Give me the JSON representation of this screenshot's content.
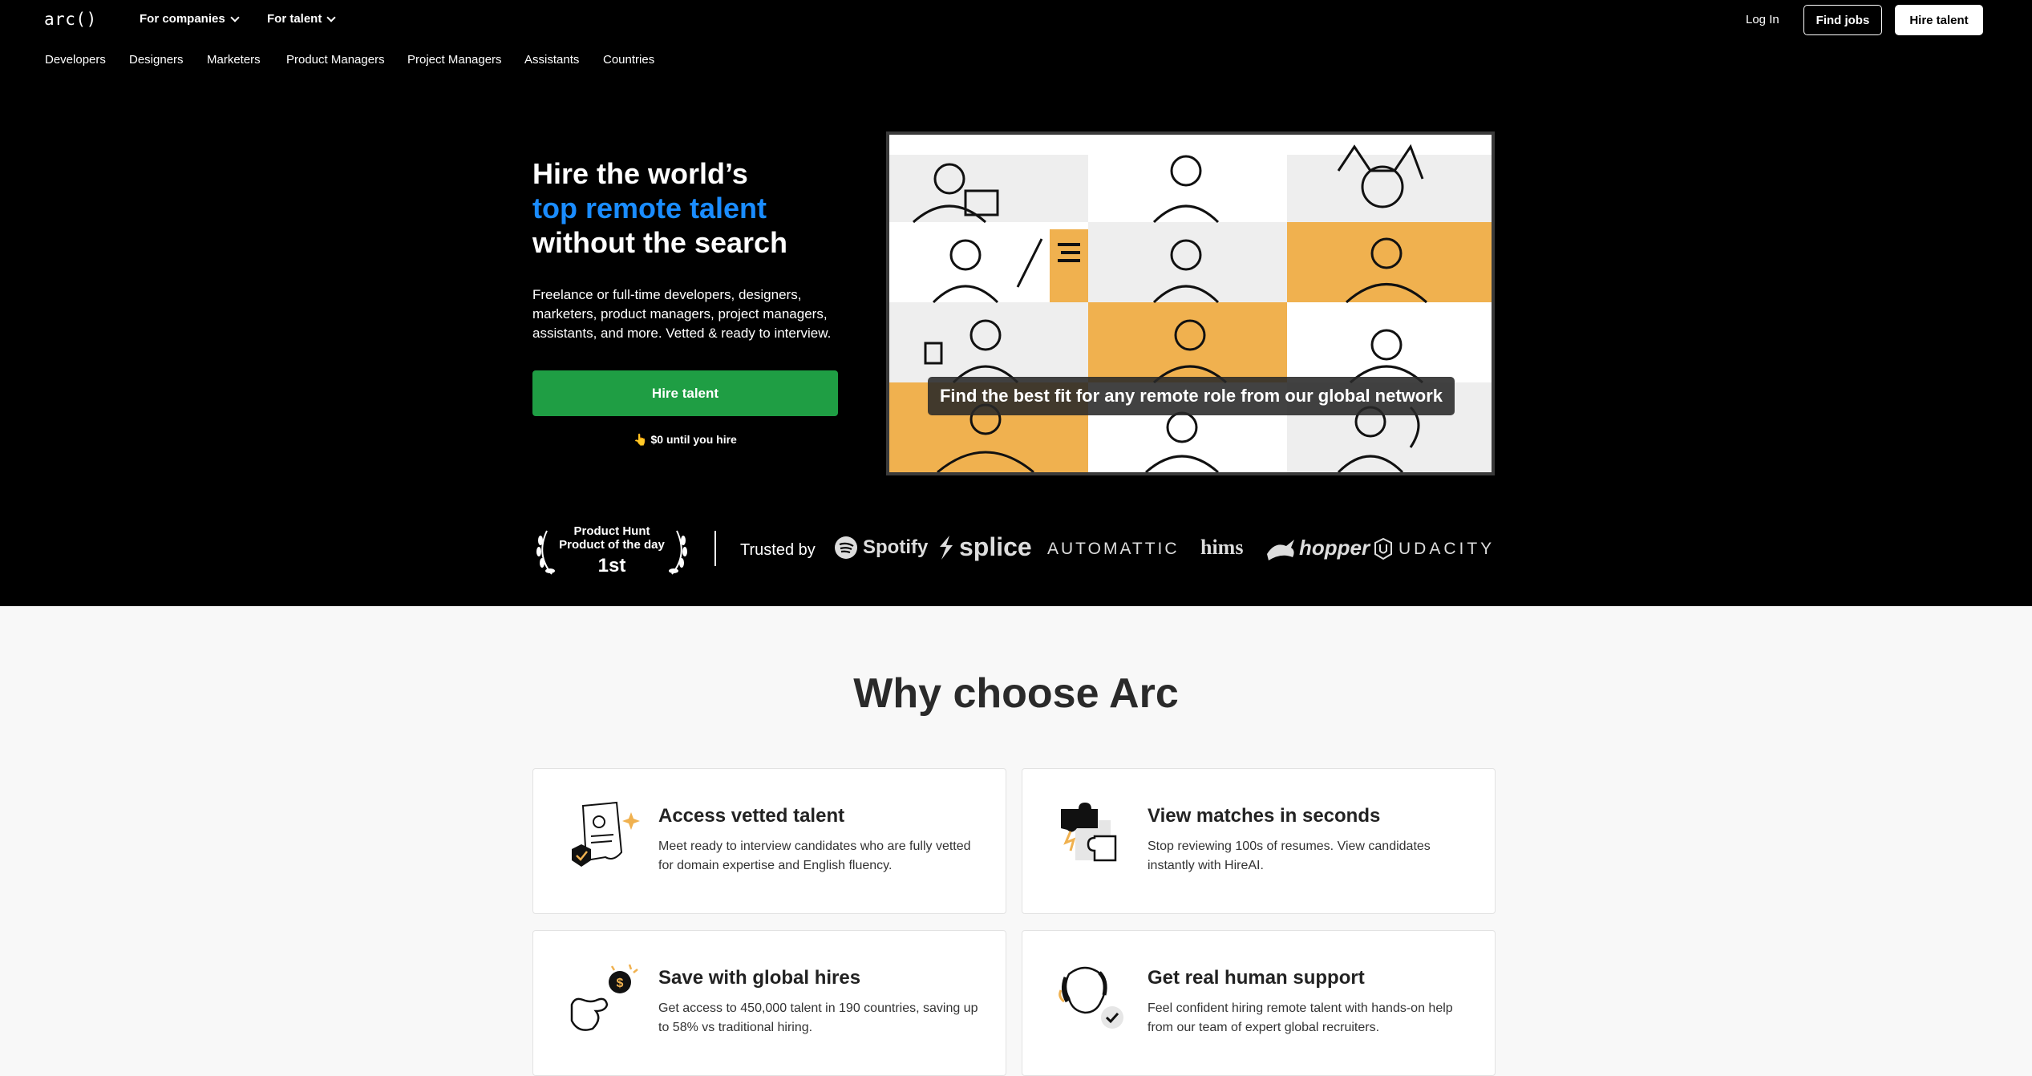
{
  "header": {
    "logo": "arc()",
    "menu": [
      {
        "label": "For companies"
      },
      {
        "label": "For talent"
      }
    ],
    "login_label": "Log In",
    "find_jobs_label": "Find jobs",
    "hire_talent_label": "Hire talent"
  },
  "subnav": [
    "Developers",
    "Designers",
    "Marketers",
    "Product Managers",
    "Project Managers",
    "Assistants",
    "Countries"
  ],
  "hero": {
    "title_line1": "Hire the world’s",
    "title_line2": "top remote talent",
    "title_line3": "without the search",
    "description": "Freelance or full-time developers, designers, marketers, product managers, project managers, assistants, and more. Vetted & ready to interview.",
    "cta_label": "Hire talent",
    "cta_note": "👆 $0 until you hire",
    "grid_caption": "Find the best fit for any remote role from our global network"
  },
  "trust": {
    "award_line1": "Product Hunt",
    "award_line2": "Product of the day",
    "award_rank": "1st",
    "trusted_label": "Trusted by",
    "brands": [
      "Spotify",
      "splice",
      "AUTOMATTIC",
      "hims",
      "hopper",
      "UDACITY"
    ]
  },
  "why": {
    "title": "Why choose Arc",
    "cards": [
      {
        "title": "Access vetted talent",
        "text": "Meet ready to interview candidates who are fully vetted for domain expertise and English fluency.",
        "icon": "vetted-document-icon"
      },
      {
        "title": "View matches in seconds",
        "text": "Stop reviewing 100s of resumes. View candidates instantly with HireAI.",
        "icon": "puzzle-icon"
      },
      {
        "title": "Save with global hires",
        "text": "Get access to 450,000 talent in 190 countries, saving up to 58% vs traditional hiring.",
        "icon": "coin-hand-icon"
      },
      {
        "title": "Get real human support",
        "text": "Feel confident hiring remote talent with hands-on help from our team of expert global recruiters.",
        "icon": "support-person-icon"
      }
    ]
  },
  "colors": {
    "accent_blue": "#1a8cff",
    "cta_green": "#1f9e44",
    "illustration_orange": "#f0b14f",
    "hero_bg": "#000000",
    "section_bg": "#f8f8f8"
  }
}
